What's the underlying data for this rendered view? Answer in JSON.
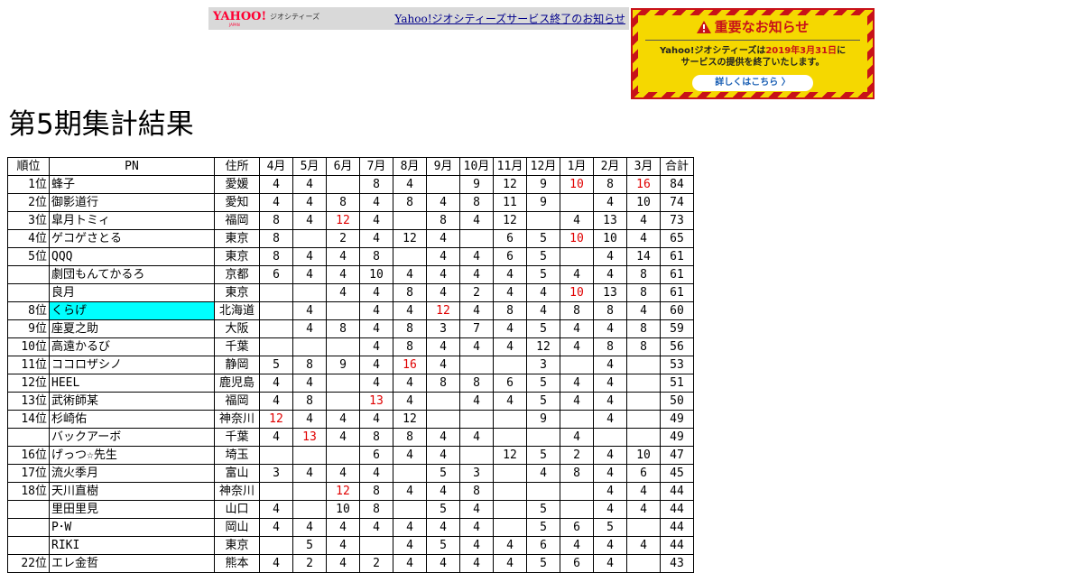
{
  "yahoo_bar": {
    "logo": "YAHOO!",
    "logo_sub": "JAPAN",
    "service": "ジオシティーズ",
    "link": "Yahoo!ジオシティーズサービス終了のお知らせ"
  },
  "notice": {
    "title": "重要なお知らせ",
    "body_pre": "Yahoo!ジオシティーズは",
    "body_date": "2019年3月31日",
    "body_post": "に",
    "body_line2": "サービスの提供を終了いたします。",
    "button": "詳しくはこちら 〉",
    "colors": {
      "red": "#c81219",
      "yellow": "#f5d800"
    }
  },
  "page_title": "第5期集計結果",
  "table": {
    "headers": [
      "順位",
      "PN",
      "住所",
      "4月",
      "5月",
      "6月",
      "7月",
      "8月",
      "9月",
      "10月",
      "11月",
      "12月",
      "1月",
      "2月",
      "3月",
      "合計"
    ],
    "highlight_color": "#00ffff",
    "emphasis_color": "#e00000",
    "rows": [
      {
        "rank": "1位",
        "name": "蜂子",
        "addr": "愛媛",
        "months": [
          "4",
          "4",
          "",
          "8",
          "4",
          "",
          "9",
          "12",
          "9",
          "10",
          "8",
          "16"
        ],
        "red": [
          9,
          11
        ],
        "total": "84"
      },
      {
        "rank": "2位",
        "name": "御影道行",
        "addr": "愛知",
        "months": [
          "4",
          "4",
          "8",
          "4",
          "8",
          "4",
          "8",
          "11",
          "9",
          "",
          "4",
          "10"
        ],
        "red": [],
        "total": "74"
      },
      {
        "rank": "3位",
        "name": "皐月トミィ",
        "addr": "福岡",
        "months": [
          "8",
          "4",
          "12",
          "4",
          "",
          "8",
          "4",
          "12",
          "",
          "4",
          "13",
          "4"
        ],
        "red": [
          2
        ],
        "total": "73"
      },
      {
        "rank": "4位",
        "name": "ゲコゲさとる",
        "addr": "東京",
        "months": [
          "8",
          "",
          "2",
          "4",
          "12",
          "4",
          "",
          "6",
          "5",
          "10",
          "10",
          "4"
        ],
        "red": [
          9
        ],
        "total": "65"
      },
      {
        "rank": "5位",
        "name": "QQQ",
        "addr": "東京",
        "months": [
          "8",
          "4",
          "4",
          "8",
          "",
          "4",
          "4",
          "6",
          "5",
          "",
          "4",
          "14"
        ],
        "red": [],
        "total": "61"
      },
      {
        "rank": "",
        "name": "劇団もんてかるろ",
        "addr": "京都",
        "months": [
          "6",
          "4",
          "4",
          "10",
          "4",
          "4",
          "4",
          "4",
          "5",
          "4",
          "4",
          "8"
        ],
        "red": [],
        "total": "61"
      },
      {
        "rank": "",
        "name": "良月",
        "addr": "東京",
        "months": [
          "",
          "",
          "4",
          "4",
          "8",
          "4",
          "2",
          "4",
          "4",
          "10",
          "13",
          "8"
        ],
        "red": [
          9
        ],
        "total": "61"
      },
      {
        "rank": "8位",
        "name": "くらげ",
        "addr": "北海道",
        "months": [
          "",
          "4",
          "",
          "4",
          "4",
          "12",
          "4",
          "8",
          "4",
          "8",
          "8",
          "4"
        ],
        "red": [
          5
        ],
        "total": "60",
        "highlight": true
      },
      {
        "rank": "9位",
        "name": "座夏之助",
        "addr": "大阪",
        "months": [
          "",
          "4",
          "8",
          "4",
          "8",
          "3",
          "7",
          "4",
          "5",
          "4",
          "4",
          "8"
        ],
        "red": [],
        "total": "59"
      },
      {
        "rank": "10位",
        "name": "高遠かるび",
        "addr": "千葉",
        "months": [
          "",
          "",
          "",
          "4",
          "8",
          "4",
          "4",
          "4",
          "12",
          "4",
          "8",
          "8"
        ],
        "red": [],
        "total": "56"
      },
      {
        "rank": "11位",
        "name": "ココロザシノ",
        "addr": "静岡",
        "months": [
          "5",
          "8",
          "9",
          "4",
          "16",
          "4",
          "",
          "",
          "3",
          "",
          "4",
          ""
        ],
        "red": [
          4
        ],
        "total": "53"
      },
      {
        "rank": "12位",
        "name": "HEEL",
        "addr": "鹿児島",
        "months": [
          "4",
          "4",
          "",
          "4",
          "4",
          "8",
          "8",
          "6",
          "5",
          "4",
          "4",
          ""
        ],
        "red": [],
        "total": "51"
      },
      {
        "rank": "13位",
        "name": "武術師某",
        "addr": "福岡",
        "months": [
          "4",
          "8",
          "",
          "13",
          "4",
          "",
          "4",
          "4",
          "5",
          "4",
          "4",
          ""
        ],
        "red": [
          3
        ],
        "total": "50"
      },
      {
        "rank": "14位",
        "name": "杉崎佑",
        "addr": "神奈川",
        "months": [
          "12",
          "4",
          "4",
          "4",
          "12",
          "",
          "",
          "",
          "9",
          "",
          "4",
          ""
        ],
        "red": [
          0
        ],
        "total": "49"
      },
      {
        "rank": "",
        "name": "バックアーボ",
        "addr": "千葉",
        "months": [
          "4",
          "13",
          "4",
          "8",
          "8",
          "4",
          "4",
          "",
          "",
          "4",
          "",
          ""
        ],
        "red": [
          1
        ],
        "total": "49"
      },
      {
        "rank": "16位",
        "name": "げっつ☆先生",
        "addr": "埼玉",
        "months": [
          "",
          "",
          "",
          "6",
          "4",
          "4",
          "",
          "12",
          "5",
          "2",
          "4",
          "10"
        ],
        "red": [],
        "total": "47"
      },
      {
        "rank": "17位",
        "name": "流火季月",
        "addr": "富山",
        "months": [
          "3",
          "4",
          "4",
          "4",
          "",
          "5",
          "3",
          "",
          "4",
          "8",
          "4",
          "6"
        ],
        "red": [],
        "total": "45"
      },
      {
        "rank": "18位",
        "name": "天川直樹",
        "addr": "神奈川",
        "months": [
          "",
          "",
          "12",
          "8",
          "4",
          "4",
          "8",
          "",
          "",
          "",
          "4",
          "4"
        ],
        "red": [
          2
        ],
        "total": "44"
      },
      {
        "rank": "",
        "name": "里田里見",
        "addr": "山口",
        "months": [
          "4",
          "",
          "10",
          "8",
          "",
          "5",
          "4",
          "",
          "5",
          "",
          "4",
          "4"
        ],
        "red": [],
        "total": "44"
      },
      {
        "rank": "",
        "name": "P･W",
        "addr": "岡山",
        "months": [
          "4",
          "4",
          "4",
          "4",
          "4",
          "4",
          "4",
          "",
          "5",
          "6",
          "5",
          ""
        ],
        "red": [],
        "total": "44"
      },
      {
        "rank": "",
        "name": "RIKI",
        "addr": "東京",
        "months": [
          "",
          "5",
          "4",
          "",
          "4",
          "5",
          "4",
          "4",
          "6",
          "4",
          "4",
          "4"
        ],
        "red": [],
        "total": "44"
      },
      {
        "rank": "22位",
        "name": "エレ金哲",
        "addr": "熊本",
        "months": [
          "4",
          "2",
          "4",
          "2",
          "4",
          "4",
          "4",
          "4",
          "5",
          "6",
          "4",
          ""
        ],
        "red": [],
        "total": "43"
      }
    ]
  }
}
